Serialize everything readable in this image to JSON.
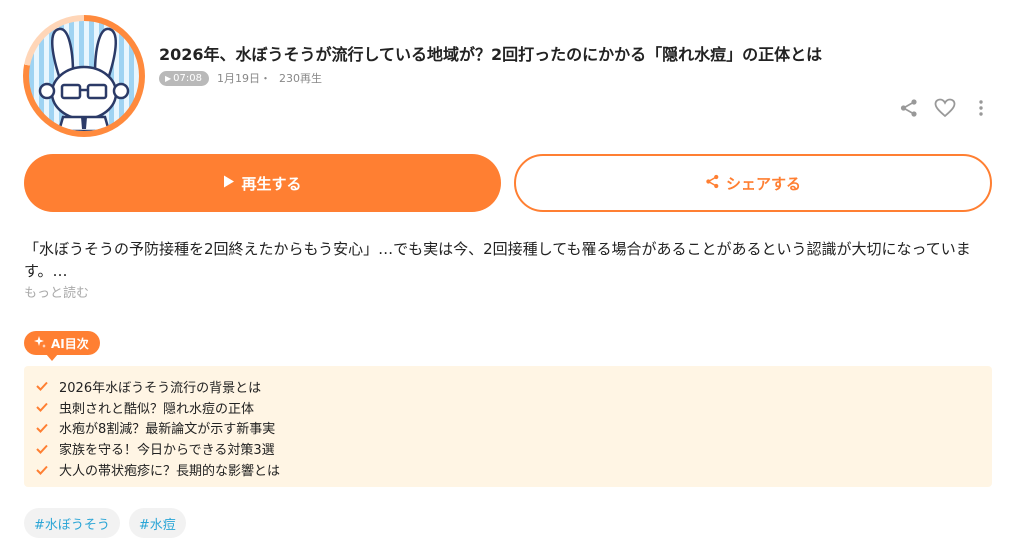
{
  "episode": {
    "title": "2026年、水ぼうそうが流行している地域が？2回打ったのにかかる「隠れ水痘」の正体とは",
    "duration": "07:08",
    "date": "1月19日・",
    "plays": "230再生"
  },
  "icons": {
    "share": "share-icon",
    "like": "heart-icon",
    "more": "more-vertical-icon",
    "play": "play-icon",
    "sparkle": "sparkle-icon",
    "check": "check-icon"
  },
  "buttons": {
    "play_label": "再生する",
    "share_label": "シェアする"
  },
  "description": {
    "text": "「水ぼうそうの予防接種を2回終えたからもう安心」…でも実は今、2回接種しても罹る場合があることがあるという認識が大切になっています。…",
    "more_label": "もっと読む"
  },
  "ai_toc": {
    "badge_label": "AI目次",
    "items": [
      "2026年水ぼうそう流行の背景とは",
      "虫刺されと酷似？隠れ水痘の正体",
      "水疱が8割減？最新論文が示す新事実",
      "家族を守る！今日からできる対策3選",
      "大人の帯状疱疹に？長期的な影響とは"
    ]
  },
  "tags": [
    "#水ぼうそう",
    "#水痘"
  ],
  "colors": {
    "accent": "#ff7f32",
    "toc_background": "#fff5e4",
    "tag_text": "#2aa5d6",
    "duration_pill": "#b9b9b9"
  }
}
